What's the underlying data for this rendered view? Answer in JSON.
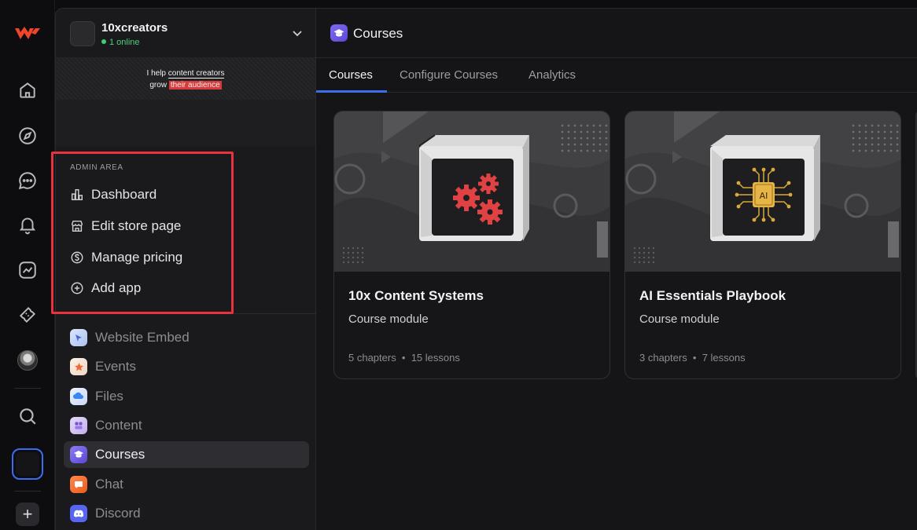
{
  "workspace": {
    "name": "10xcreators",
    "online_status": "1 online",
    "banner_line1_prefix": "I help ",
    "banner_line1_emph": "content creators",
    "banner_line2_prefix": "grow ",
    "banner_line2_hl": "their audience"
  },
  "admin": {
    "label": "ADMIN AREA",
    "items": [
      {
        "label": "Dashboard",
        "icon": "bar-chart-icon"
      },
      {
        "label": "Edit store page",
        "icon": "store-icon"
      },
      {
        "label": "Manage pricing",
        "icon": "dollar-circle-icon"
      },
      {
        "label": "Add app",
        "icon": "plus-circle-icon"
      }
    ]
  },
  "apps": [
    {
      "label": "Website Embed",
      "icon": "website-embed-icon",
      "color": "#c9d7f5"
    },
    {
      "label": "Events",
      "icon": "events-icon",
      "color": "#f3e3d6"
    },
    {
      "label": "Files",
      "icon": "files-icon",
      "color": "#dfe7f7"
    },
    {
      "label": "Content",
      "icon": "content-icon",
      "color": "#d9c9f2"
    },
    {
      "label": "Courses",
      "icon": "courses-icon",
      "color": "#6d5ee8",
      "active": true
    },
    {
      "label": "Chat",
      "icon": "chat-icon",
      "color": "#f26b2c"
    },
    {
      "label": "Discord",
      "icon": "discord-icon",
      "color": "#5865f2"
    }
  ],
  "main": {
    "title": "Courses",
    "tabs": [
      "Courses",
      "Configure Courses",
      "Analytics"
    ],
    "active_tab": "Courses"
  },
  "courses": [
    {
      "title": "10x Content Systems",
      "subtitle": "Course module",
      "chapters": "5 chapters",
      "lessons": "15 lessons",
      "art": "gears"
    },
    {
      "title": "AI Essentials Playbook",
      "subtitle": "Course module",
      "chapters": "3 chapters",
      "lessons": "7 lessons",
      "art": "ai-chip",
      "chip_label": "AI"
    }
  ],
  "colors": {
    "accent": "#3d6de8",
    "highlight_box": "#e8323d",
    "online": "#3ecf6e"
  }
}
